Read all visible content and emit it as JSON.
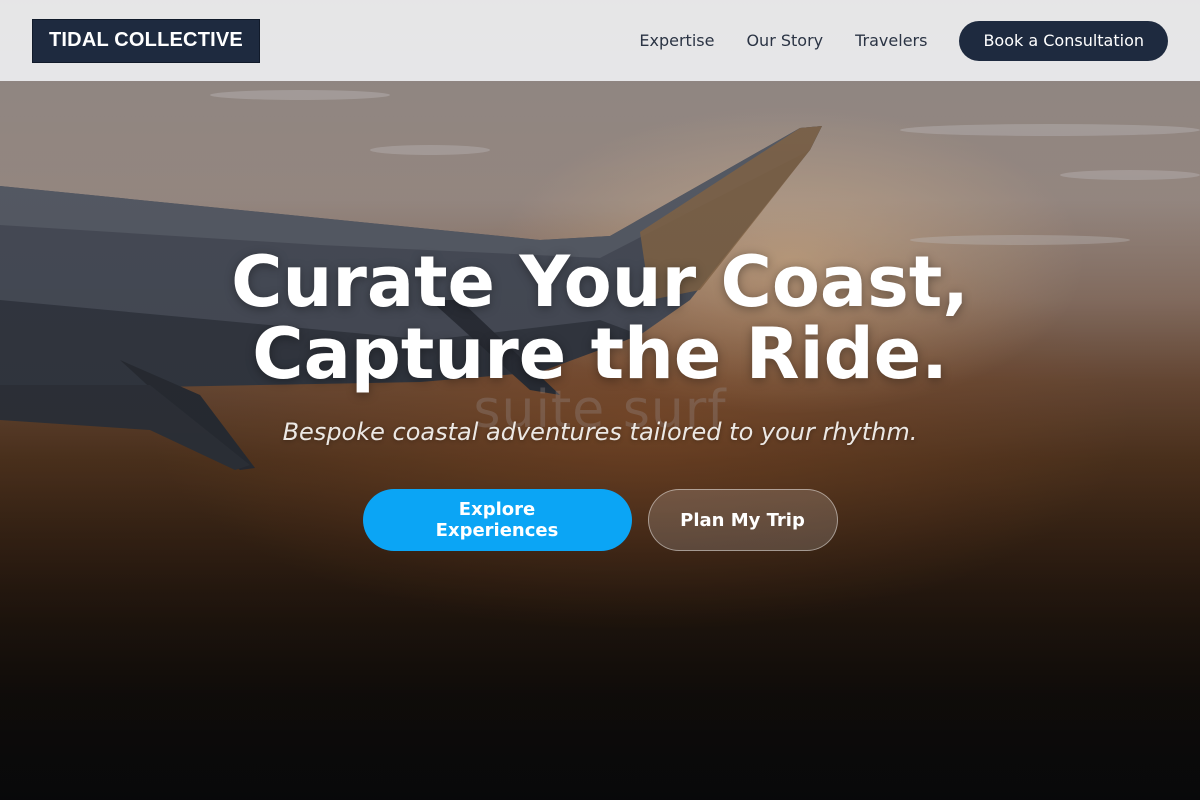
{
  "brand": {
    "name": "TIDAL COLLECTIVE"
  },
  "nav": {
    "links": [
      {
        "label": "Expertise"
      },
      {
        "label": "Our Story"
      },
      {
        "label": "Travelers"
      }
    ],
    "cta_label": "Book a Consultation"
  },
  "hero": {
    "title_line1": "Curate Your Coast,",
    "title_line2": "Capture the Ride.",
    "watermark": "suite surf",
    "subtitle": "Bespoke coastal adventures tailored to your rhythm.",
    "primary_button": "Explore Experiences",
    "secondary_button": "Plan My Trip"
  },
  "colors": {
    "brand_dark": "#1e2a3f",
    "accent": "#0ba5f5",
    "nav_bg": "#ececee",
    "text_white": "#ffffff"
  }
}
